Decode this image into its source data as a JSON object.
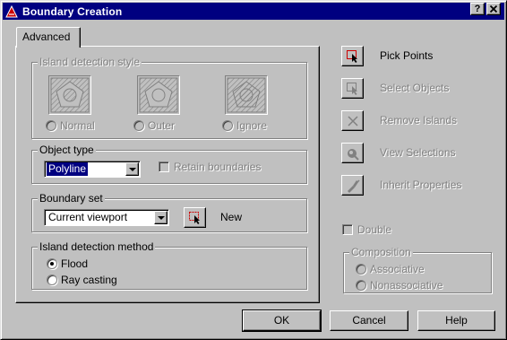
{
  "window": {
    "title": "Boundary Creation",
    "help_btn": "?",
    "close_btn": "✕"
  },
  "tab": {
    "label": "Advanced"
  },
  "island_style": {
    "label": "Island detection style",
    "options": [
      {
        "label": "Normal",
        "selected": false
      },
      {
        "label": "Outer",
        "selected": false
      },
      {
        "label": "Ignore",
        "selected": false
      }
    ]
  },
  "object_type": {
    "label": "Object type",
    "value": "Polyline",
    "retain_label": "Retain boundaries"
  },
  "boundary_set": {
    "label": "Boundary set",
    "value": "Current viewport",
    "new_label": "New"
  },
  "island_method": {
    "label": "Island detection method",
    "options": [
      {
        "label": "Flood",
        "selected": true
      },
      {
        "label": "Ray casting",
        "selected": false
      }
    ]
  },
  "actions": [
    {
      "label": "Pick Points",
      "icon": "pick-points-icon",
      "enabled": true
    },
    {
      "label": "Select Objects",
      "icon": "select-objects-icon",
      "enabled": false
    },
    {
      "label": "Remove Islands",
      "icon": "remove-islands-icon",
      "enabled": false
    },
    {
      "label": "View Selections",
      "icon": "view-selections-icon",
      "enabled": false
    },
    {
      "label": "Inherit Properties",
      "icon": "inherit-properties-icon",
      "enabled": false
    }
  ],
  "double": {
    "label": "Double"
  },
  "composition": {
    "label": "Composition",
    "options": [
      {
        "label": "Associative",
        "selected": false
      },
      {
        "label": "Nonassociative",
        "selected": false
      }
    ]
  },
  "buttons": {
    "ok": "OK",
    "cancel": "Cancel",
    "help": "Help"
  },
  "colors": {
    "face": "#c0c0c0",
    "title_bar": "#000080",
    "disabled_text": "#808080",
    "selection": "#000080",
    "autocad_red": "#cc0000"
  }
}
